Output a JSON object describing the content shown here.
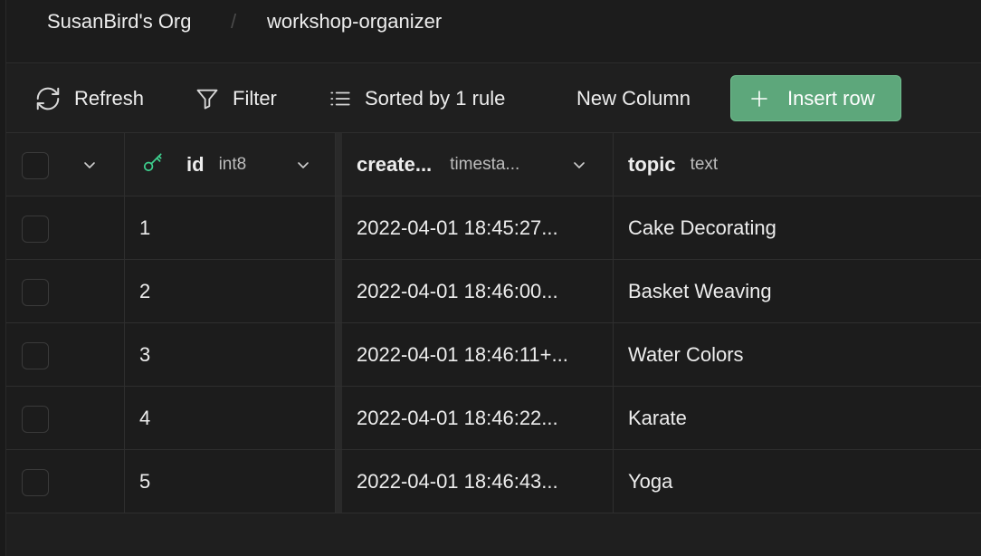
{
  "breadcrumb": {
    "org": "SusanBird's Org",
    "separator": "/",
    "project": "workshop-organizer"
  },
  "toolbar": {
    "refresh_label": "Refresh",
    "filter_label": "Filter",
    "sort_label": "Sorted by 1 rule",
    "new_column_label": "New Column",
    "insert_row_label": "Insert row"
  },
  "columns": {
    "id": {
      "name": "id",
      "type": "int8"
    },
    "created": {
      "name": "create...",
      "type": "timesta..."
    },
    "topic": {
      "name": "topic",
      "type": "text"
    }
  },
  "rows": [
    {
      "id": "1",
      "created_at": "2022-04-01 18:45:27...",
      "topic": "Cake Decorating"
    },
    {
      "id": "2",
      "created_at": "2022-04-01 18:46:00...",
      "topic": "Basket Weaving"
    },
    {
      "id": "3",
      "created_at": "2022-04-01 18:46:11+...",
      "topic": "Water Colors"
    },
    {
      "id": "4",
      "created_at": "2022-04-01 18:46:22...",
      "topic": "Karate"
    },
    {
      "id": "5",
      "created_at": "2022-04-01 18:46:43...",
      "topic": "Yoga"
    }
  ],
  "colors": {
    "background": "#1c1c1c",
    "accent": "#5da77b",
    "key_icon": "#3ecf8e",
    "border": "#2e2e2e"
  },
  "icons": [
    "refresh-icon",
    "filter-icon",
    "sort-icon",
    "plus-icon",
    "chevron-down-icon",
    "primary-key-icon"
  ]
}
